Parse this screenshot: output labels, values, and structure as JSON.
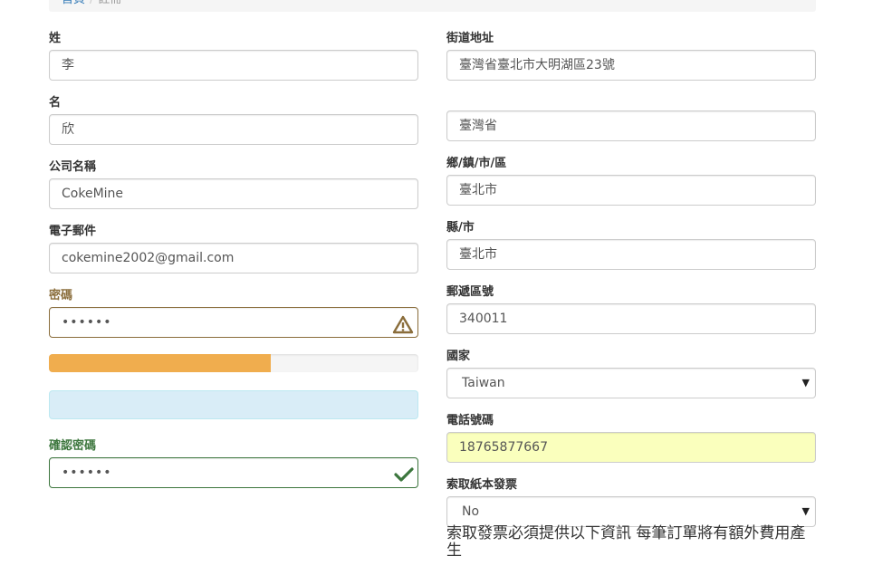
{
  "breadcrumb": {
    "home": "首頁",
    "current": "註冊"
  },
  "left": {
    "last_name": {
      "label": "姓",
      "value": "李"
    },
    "first_name": {
      "label": "名",
      "value": "欣"
    },
    "company": {
      "label": "公司名稱",
      "value": "CokeMine"
    },
    "email": {
      "label": "電子郵件",
      "value": "cokemine2002@gmail.com"
    },
    "password": {
      "label": "密碼",
      "value": "••••••"
    },
    "password_strength": {
      "fraction": 0.6,
      "color": "#f0ad4e"
    },
    "confirm_password": {
      "label": "確認密碼",
      "value": "••••••"
    }
  },
  "right": {
    "street": {
      "label": "街道地址",
      "value": "臺灣省臺北市大明湖區23號"
    },
    "street2": {
      "value": "臺灣省"
    },
    "town": {
      "label": "鄉/鎮/市/區",
      "value": "臺北市"
    },
    "county": {
      "label": "縣/市",
      "value": "臺北市"
    },
    "postcode": {
      "label": "郵遞區號",
      "value": "340011"
    },
    "country": {
      "label": "國家",
      "value": "Taiwan"
    },
    "phone": {
      "label": "電話號碼",
      "value": "18765877667"
    },
    "invoice": {
      "label": "索取紙本發票",
      "value": "No"
    },
    "invoice_note": "索取發票必須提供以下資訊 每筆訂單將有額外費用產生"
  },
  "icons": {
    "warning": "warning-triangle-icon",
    "valid": "checkmark-icon",
    "dropdown": "caret-down-icon"
  },
  "colors": {
    "warning": "#8a6d3b",
    "success": "#3c763d",
    "autofill": "#faffbd",
    "info_bg": "#d9edf7"
  }
}
